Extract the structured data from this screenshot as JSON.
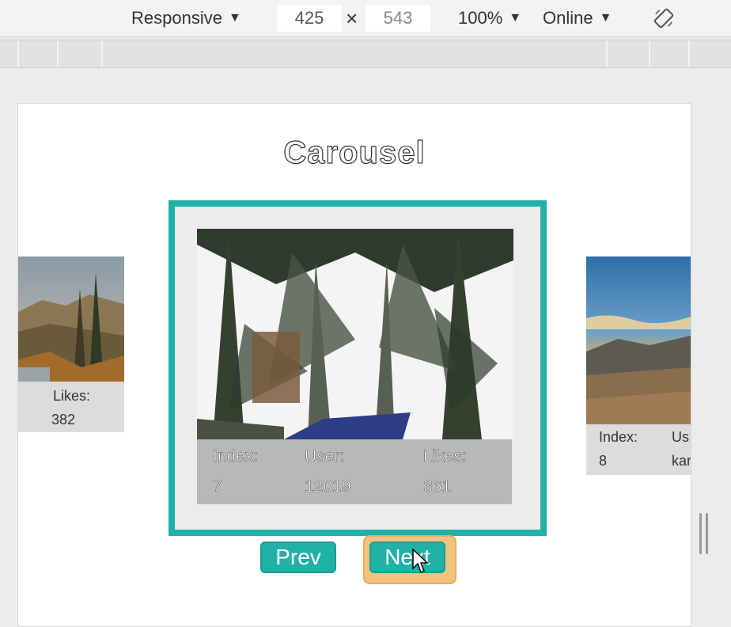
{
  "toolbar": {
    "device_mode": "Responsive",
    "width": "425",
    "height": "543",
    "dimension_separator": "×",
    "zoom": "100%",
    "network": "Online",
    "rotate_icon": "rotate-icon"
  },
  "page": {
    "title": "Carousel"
  },
  "carousel": {
    "left_card": {
      "likes_label": "Likes:",
      "likes_value": "382"
    },
    "main_card": {
      "index_label": "Index:",
      "index_value": "7",
      "user_label": "User:",
      "user_value": "12019",
      "likes_label": "Likes:",
      "likes_value": "361"
    },
    "right_card": {
      "index_label": "Index:",
      "index_value": "8",
      "user_label": "Us",
      "user_value": "kar"
    }
  },
  "controls": {
    "prev_label": "Prev",
    "next_label": "Next"
  },
  "colors": {
    "accent": "#22b1a6",
    "focus_ring": "#f2c27f"
  }
}
